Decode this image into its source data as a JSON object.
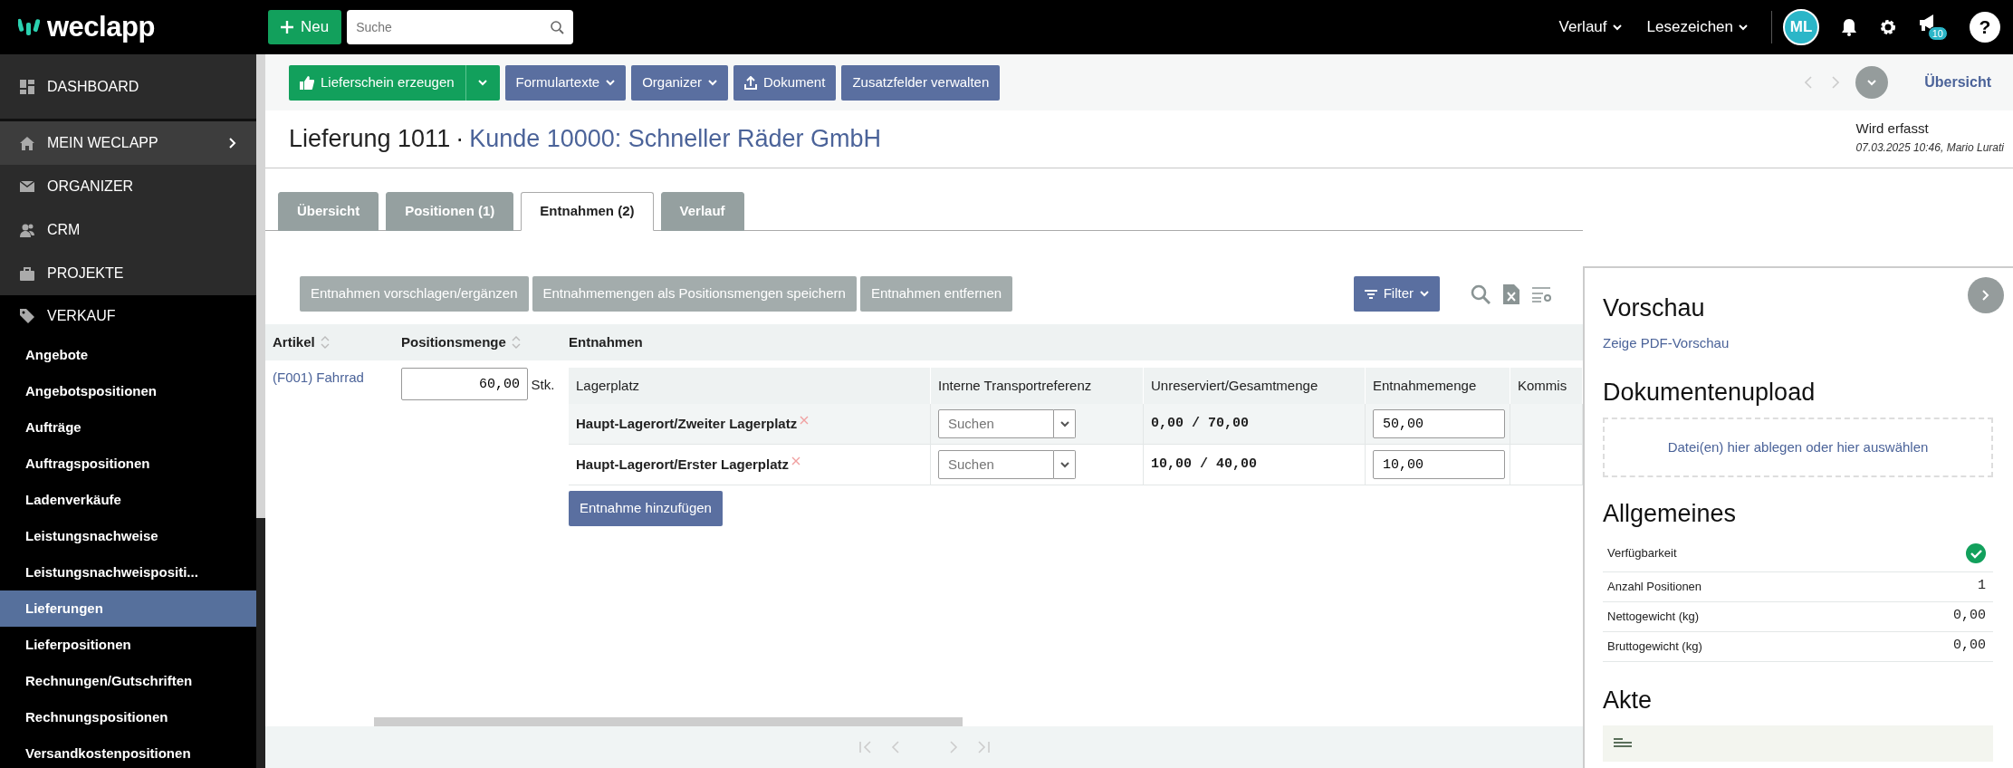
{
  "top_bar": {
    "logo": "weclapp",
    "new_button": "Neu",
    "search": {
      "placeholder": "Suche"
    },
    "menus": [
      "Verlauf",
      "Lesezeichen"
    ],
    "avatar": "ML",
    "notification_badge": "10",
    "help": "?"
  },
  "sidebar": {
    "items": [
      {
        "label": "DASHBOARD",
        "hovered": false,
        "submenu": false
      },
      {
        "label": "MEIN WECLAPP",
        "hovered": true,
        "submenu": true
      },
      {
        "label": "ORGANIZER",
        "hovered": false,
        "submenu": false
      },
      {
        "label": "CRM",
        "hovered": false,
        "submenu": false
      },
      {
        "label": "PROJEKTE",
        "hovered": false,
        "submenu": false
      },
      {
        "label": "VERKAUF",
        "hovered": false,
        "submenu": false,
        "children": [
          {
            "label": "Angebote",
            "selected": false
          },
          {
            "label": "Angebotspositionen",
            "selected": false
          },
          {
            "label": "Aufträge",
            "selected": false
          },
          {
            "label": "Auftragspositionen",
            "selected": false
          },
          {
            "label": "Ladenverkäufe",
            "selected": false
          },
          {
            "label": "Leistungsnachweise",
            "selected": false
          },
          {
            "label": "Leistungsnachweispositi...",
            "selected": false
          },
          {
            "label": "Lieferungen",
            "selected": true
          },
          {
            "label": "Lieferpositionen",
            "selected": false
          },
          {
            "label": "Rechnungen/Gutschriften",
            "selected": false
          },
          {
            "label": "Rechnungspositionen",
            "selected": false
          },
          {
            "label": "Versandkostenpositionen",
            "selected": false
          }
        ]
      }
    ]
  },
  "toolbar": {
    "buttons": [
      {
        "label": "Lieferschein erzeugen",
        "kind": "split"
      },
      {
        "label": "Formulartexte",
        "kind": "dropdown"
      },
      {
        "label": "Organizer",
        "kind": "dropdown"
      },
      {
        "label": "Dokument",
        "kind": "upload"
      },
      {
        "label": "Zusatzfelder verwalten",
        "kind": "plain"
      }
    ],
    "overview_link": "Übersicht"
  },
  "header": {
    "title": "Lieferung 1011",
    "separator": "·",
    "customer_link": "Kunde 10000: Schneller Räder GmbH",
    "status": "Wird erfasst",
    "meta": "07.03.2025 10:46, Mario Lurati"
  },
  "tabs": [
    {
      "label": "Übersicht",
      "selected": false
    },
    {
      "label": "Positionen (1)",
      "selected": false
    },
    {
      "label": "Entnahmen (2)",
      "selected": true
    },
    {
      "label": "Verlauf",
      "selected": false
    }
  ],
  "actions": {
    "buttons": [
      {
        "label": "Entnahmen vorschlagen/ergänzen",
        "disabled": true
      },
      {
        "label": "Entnahmemengen als Positionsmengen speichern",
        "disabled": true
      },
      {
        "label": "Entnahmen entfernen",
        "disabled": true
      }
    ],
    "filter": "Filter"
  },
  "table": {
    "columns": [
      {
        "label": "Artikel",
        "sortable": true
      },
      {
        "label": "Positionsmenge",
        "sortable": true
      },
      {
        "label": "Entnahmen",
        "sortable": false
      }
    ],
    "rows": [
      {
        "article": "(F001) Fahrrad",
        "quantity": "60,00",
        "unit": "Stk.",
        "withdrawals": {
          "columns": [
            "Lagerplatz",
            "Interne Transportreferenz",
            "Unreserviert/Gesamtmenge",
            "Entnahmemenge",
            "Kommis"
          ],
          "rows": [
            {
              "location": "Haupt-Lagerort/Zweiter Lagerplatz",
              "transport_ref": {
                "placeholder": "Suchen"
              },
              "stock": "0,00 / 70,00",
              "amount": "50,00"
            },
            {
              "location": "Haupt-Lagerort/Erster Lagerplatz",
              "transport_ref": {
                "placeholder": "Suchen"
              },
              "stock": "10,00 / 40,00",
              "amount": "10,00"
            }
          ],
          "add_button": "Entnahme hinzufügen"
        }
      }
    ]
  },
  "panel": {
    "preview": {
      "title": "Vorschau",
      "link": "Zeige PDF-Vorschau"
    },
    "upload": {
      "title": "Dokumentenupload",
      "dropzone": "Datei(en) hier ablegen oder hier auswählen"
    },
    "general": {
      "title": "Allgemeines",
      "rows": [
        {
          "label": "Verfügbarkeit",
          "kind": "status",
          "available": true
        },
        {
          "label": "Anzahl Positionen",
          "kind": "text",
          "value": "1"
        },
        {
          "label": "Nettogewicht (kg)",
          "kind": "text",
          "value": "0,00"
        },
        {
          "label": "Bruttogewicht (kg)",
          "kind": "text",
          "value": "0,00"
        }
      ]
    },
    "file": {
      "title": "Akte"
    }
  }
}
